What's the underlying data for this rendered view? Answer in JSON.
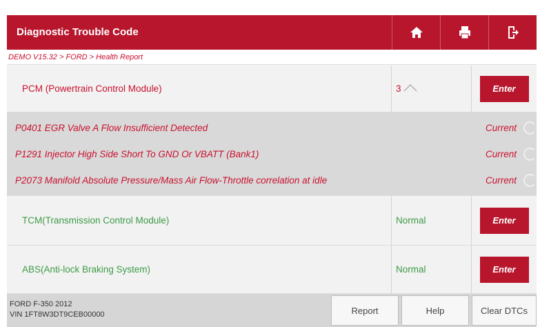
{
  "header": {
    "title": "Diagnostic Trouble Code",
    "icons": [
      "home-icon",
      "print-icon",
      "exit-icon"
    ]
  },
  "breadcrumb": "DEMO V15.32 > FORD > Health Report",
  "modules": [
    {
      "name": "PCM (Powertrain Control Module)",
      "status": "3",
      "enter_label": "Enter"
    },
    {
      "name": "TCM(Transmission Control Module)",
      "status": "Normal",
      "enter_label": "Enter"
    },
    {
      "name": "ABS(Anti-lock Braking System)",
      "status": "Normal",
      "enter_label": "Enter"
    }
  ],
  "dtcs": [
    {
      "description": "P0401 EGR Valve A Flow Insufficient Detected",
      "state": "Current"
    },
    {
      "description": "P1291 Injector High Side Short To GND Or VBATT (Bank1)",
      "state": "Current"
    },
    {
      "description": "P2073 Manifold Absolute Pressure/Mass Air Flow-Throttle correlation at idle",
      "state": "Current"
    }
  ],
  "footer": {
    "vehicle": "FORD F-350 2012",
    "vin": "VIN 1FT8W3DT9CEB00000",
    "buttons": {
      "report": "Report",
      "help": "Help",
      "clear": "Clear DTCs"
    }
  },
  "colors": {
    "accent": "#b8162c",
    "fault_text": "#c8102e",
    "normal_text": "#3c9a46"
  }
}
